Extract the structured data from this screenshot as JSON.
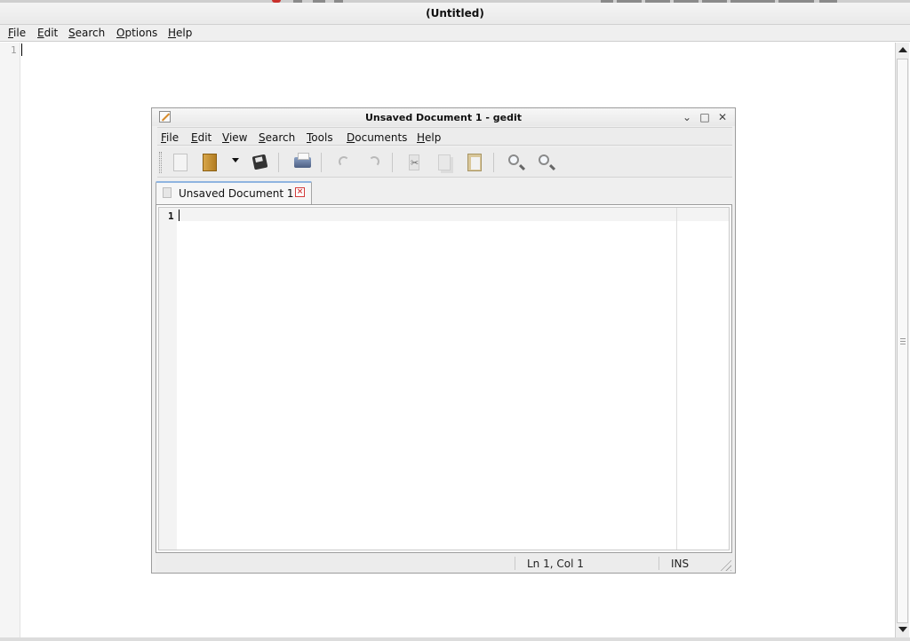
{
  "outer": {
    "title": "(Untitled)",
    "menu": [
      {
        "key": "F",
        "rest": "ile"
      },
      {
        "key": "E",
        "rest": "dit"
      },
      {
        "key": "S",
        "rest": "earch"
      },
      {
        "key": "O",
        "rest": "ptions"
      },
      {
        "key": "H",
        "rest": "elp"
      }
    ],
    "line_number": "1"
  },
  "gedit": {
    "title": "Unsaved Document 1 - gedit",
    "wm": {
      "shade": "⌄",
      "maximize": "□",
      "close": "✕"
    },
    "menu": [
      {
        "key": "F",
        "rest": "ile"
      },
      {
        "key": "E",
        "rest": "dit"
      },
      {
        "key": "V",
        "rest": "iew"
      },
      {
        "key": "S",
        "rest": "earch"
      },
      {
        "key": "T",
        "rest": "ools"
      },
      {
        "key": "D",
        "rest": "ocuments"
      },
      {
        "key": "H",
        "rest": "elp"
      }
    ],
    "toolbar": {
      "icons": [
        "new-document-icon",
        "open-folder-icon",
        "dropdown-arrow-icon",
        "save-disk-icon",
        "print-icon",
        "undo-icon",
        "redo-icon",
        "cut-icon",
        "copy-icon",
        "paste-icon",
        "find-icon",
        "find-replace-icon"
      ]
    },
    "tab": {
      "label": "Unsaved Document 1",
      "close": "×"
    },
    "editor": {
      "line_number": "1"
    },
    "status": {
      "position": "Ln 1, Col 1",
      "mode": "INS"
    }
  }
}
